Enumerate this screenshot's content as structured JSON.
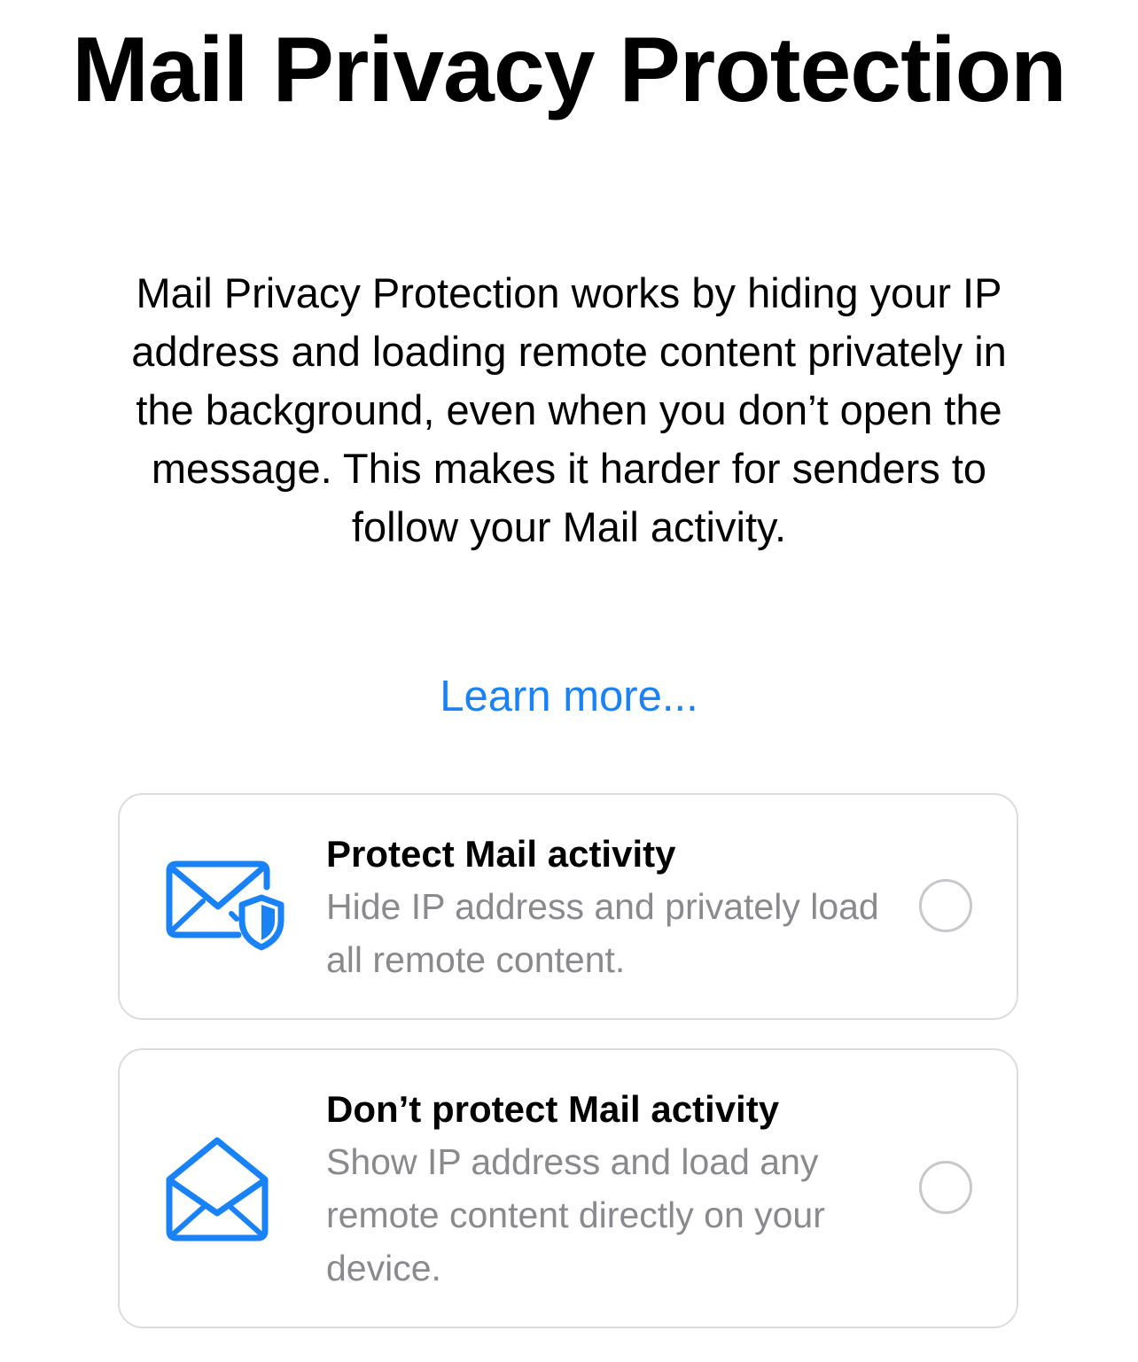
{
  "title": "Mail Privacy Protection",
  "description": "Mail Privacy Protection works by hiding your IP address and loading remote content privately in the background, even when you don’t open the message. This makes it harder for senders to follow your Mail activity.",
  "learn_more": "Learn more...",
  "accent_color": "#1a82f7",
  "options": [
    {
      "icon": "envelope-shield-icon",
      "title": "Protect Mail activity",
      "subtitle": "Hide IP address and privately load all remote content.",
      "selected": false
    },
    {
      "icon": "open-envelope-icon",
      "title": "Don’t protect Mail activity",
      "subtitle": "Show IP address and load any remote content directly on your device.",
      "selected": false
    }
  ]
}
